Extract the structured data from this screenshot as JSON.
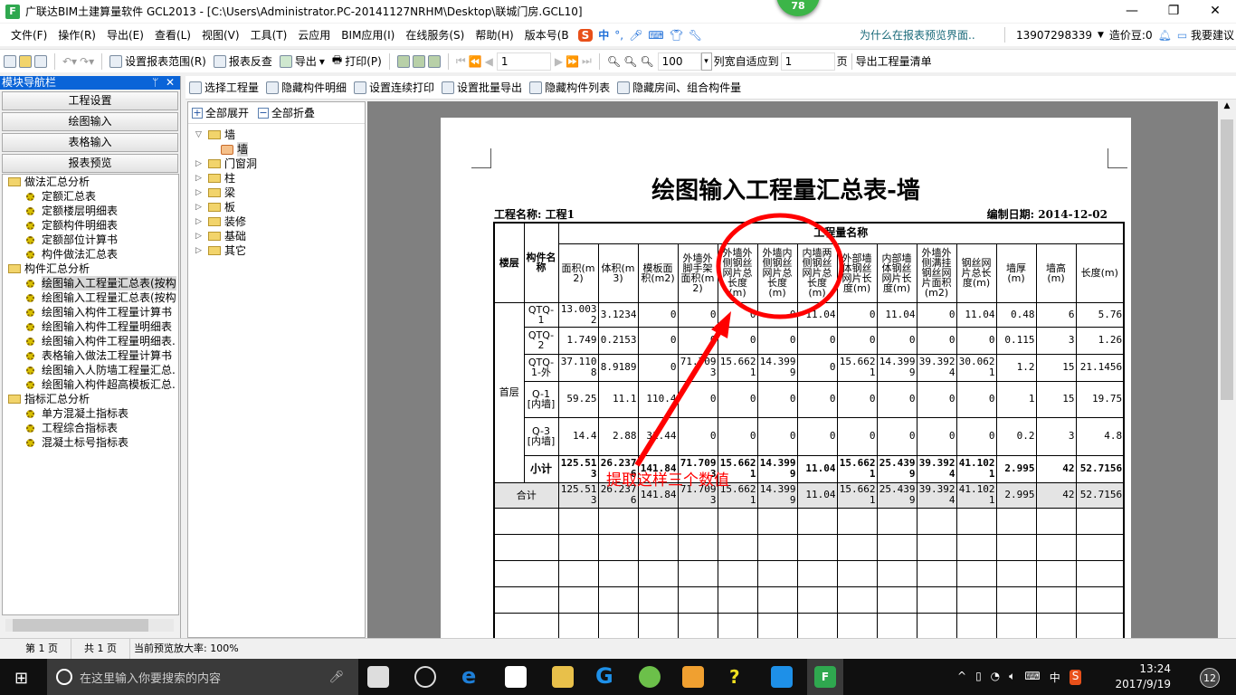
{
  "window": {
    "title": "广联达BIM土建算量软件 GCL2013 - [C:\\Users\\Administrator.PC-20141127NRHM\\Desktop\\联城门房.GCL10]",
    "badge": "78",
    "minimize": "—",
    "restore": "❐",
    "close": "✕"
  },
  "menu": [
    "文件(F)",
    "操作(R)",
    "导出(E)",
    "查看(L)",
    "视图(V)",
    "工具(T)",
    "云应用",
    "BIM应用(I)",
    "在线服务(S)",
    "帮助(H)",
    "版本号(B"
  ],
  "ime": {
    "label": "中",
    "punct": "°,"
  },
  "help_link": "为什么在报表预览界面..",
  "account": {
    "phone": "13907298339",
    "beans": "造价豆:0",
    "suggest": "我要建议"
  },
  "toolbar": {
    "set_range": "设置报表范围(R)",
    "check": "报表反查",
    "export": "导出",
    "print": "打印(P)",
    "page": "1",
    "zoom": "100",
    "fit_label": "列宽自适应到",
    "fit_value": "1",
    "page_unit": "页",
    "export_list": "导出工程量清单"
  },
  "nav": {
    "title": "模块导航栏",
    "pin": "ᛘ",
    "close": "✕",
    "buttons": [
      "工程设置",
      "绘图输入",
      "表格输入",
      "报表预览"
    ],
    "tree": [
      {
        "label": "做法汇总分析",
        "type": "folder"
      },
      {
        "label": "定额汇总表",
        "type": "item"
      },
      {
        "label": "定额楼层明细表",
        "type": "item"
      },
      {
        "label": "定额构件明细表",
        "type": "item"
      },
      {
        "label": "定额部位计算书",
        "type": "item"
      },
      {
        "label": "构件做法汇总表",
        "type": "item"
      },
      {
        "label": "构件汇总分析",
        "type": "folder"
      },
      {
        "label": "绘图输入工程量汇总表(按构",
        "type": "item",
        "selected": true
      },
      {
        "label": "绘图输入工程量汇总表(按构",
        "type": "item"
      },
      {
        "label": "绘图输入构件工程量计算书",
        "type": "item"
      },
      {
        "label": "绘图输入构件工程量明细表",
        "type": "item"
      },
      {
        "label": "绘图输入构件工程量明细表.",
        "type": "item"
      },
      {
        "label": "表格输入做法工程量计算书",
        "type": "item"
      },
      {
        "label": "绘图输入人防墙工程量汇总.",
        "type": "item"
      },
      {
        "label": "绘图输入构件超高模板汇总.",
        "type": "item"
      },
      {
        "label": "指标汇总分析",
        "type": "folder"
      },
      {
        "label": "单方混凝土指标表",
        "type": "item"
      },
      {
        "label": "工程综合指标表",
        "type": "item"
      },
      {
        "label": "混凝土标号指标表",
        "type": "item"
      }
    ]
  },
  "toolbar2": [
    "选择工程量",
    "隐藏构件明细",
    "设置连续打印",
    "设置批量导出",
    "隐藏构件列表",
    "隐藏房间、组合构件量"
  ],
  "tree2": {
    "expand_all": "全部展开",
    "collapse_all": "全部折叠",
    "items": [
      {
        "label": "墙",
        "open": true
      },
      {
        "label": "墙",
        "child": true
      },
      {
        "label": "门窗洞"
      },
      {
        "label": "柱"
      },
      {
        "label": "梁"
      },
      {
        "label": "板"
      },
      {
        "label": "装修"
      },
      {
        "label": "基础"
      },
      {
        "label": "其它"
      }
    ]
  },
  "report": {
    "title": "绘图输入工程量汇总表-墙",
    "project": "工程名称: 工程1",
    "date": "编制日期: 2014-12-02",
    "group_header": "工程量名称",
    "floor_header": "楼层",
    "name_header": "构件名称",
    "columns": [
      "面积(m2)",
      "体积(m3)",
      "模板面积(m2)",
      "外墙外脚手架面积(m2)",
      "外墙外侧钢丝网片总长度(m)",
      "外墙内侧钢丝网片总长度(m)",
      "内墙两侧钢丝网片总长度(m)",
      "外部墙体钢丝网片长度(m)",
      "内部墙体钢丝网片长度(m)",
      "外墙外侧满挂钢丝网片面积(m2)",
      "钢丝网片总长度(m)",
      "墙厚(m)",
      "墙高(m)",
      "长度(m)"
    ],
    "floor": "首层",
    "rows": [
      {
        "name": "QTQ-1",
        "values": [
          "13.0032",
          "3.1234",
          "0",
          "0",
          "0",
          "0",
          "11.04",
          "0",
          "11.04",
          "0",
          "11.04",
          "0.48",
          "6",
          "5.76"
        ]
      },
      {
        "name": "QTQ-2",
        "values": [
          "1.749",
          "0.2153",
          "0",
          "0",
          "0",
          "0",
          "0",
          "0",
          "0",
          "0",
          "0",
          "0.115",
          "3",
          "1.26"
        ]
      },
      {
        "name": "QTQ-1-外",
        "values": [
          "37.1108",
          "8.9189",
          "0",
          "71.7093",
          "15.6621",
          "14.3999",
          "0",
          "15.6621",
          "14.3999",
          "39.3924",
          "30.0621",
          "1.2",
          "15",
          "21.1456"
        ]
      },
      {
        "name": "Q-1[内墙]",
        "values": [
          "59.25",
          "11.1",
          "110.4",
          "0",
          "0",
          "0",
          "0",
          "0",
          "0",
          "0",
          "0",
          "1",
          "15",
          "19.75"
        ]
      },
      {
        "name": "Q-3[内墙]",
        "values": [
          "14.4",
          "2.88",
          "31.44",
          "0",
          "0",
          "0",
          "0",
          "0",
          "0",
          "0",
          "0",
          "0.2",
          "3",
          "4.8"
        ]
      }
    ],
    "subtotal": {
      "label": "小计",
      "values": [
        "125.513",
        "26.2376",
        "141.84",
        "71.7093",
        "15.6621",
        "14.3999",
        "11.04",
        "15.6621",
        "25.4399",
        "39.3924",
        "41.1021",
        "2.995",
        "42",
        "52.7156"
      ]
    },
    "total": {
      "label": "合计",
      "values": [
        "125.513",
        "26.2376",
        "141.84",
        "71.7093",
        "15.6621",
        "14.3999",
        "11.04",
        "15.6621",
        "25.4399",
        "39.3924",
        "41.1021",
        "2.995",
        "42",
        "52.7156"
      ]
    }
  },
  "annotation": {
    "text": "提取这样三个数值",
    "color": "#ff0000"
  },
  "status": {
    "page": "第 1 页",
    "total": "共 1 页",
    "zoom": "当前预览放大率: 100%"
  },
  "taskbar": {
    "search_placeholder": "在这里输入你要搜索的内容",
    "time": "13:24",
    "date": "2017/9/19",
    "ime": "中",
    "notif": "12"
  }
}
